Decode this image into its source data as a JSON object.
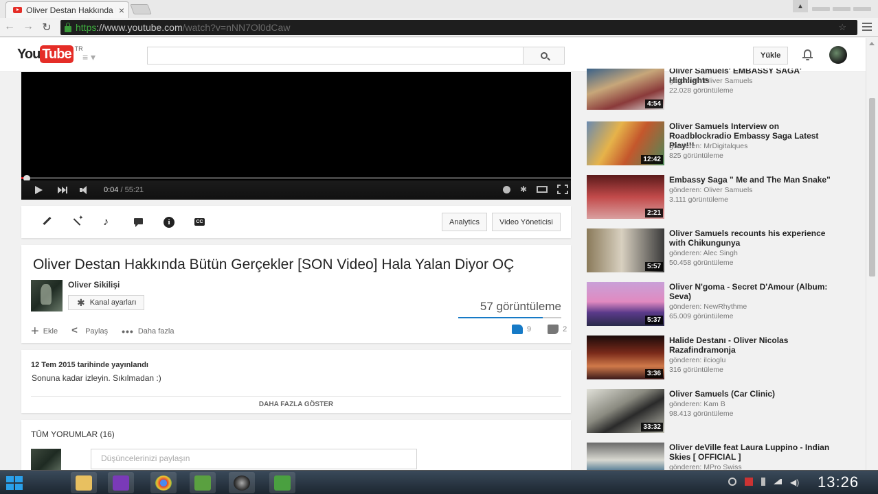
{
  "browser": {
    "tab_title": "Oliver Destan Hakkında Bü",
    "tab_close": "×",
    "url_https": "https",
    "url_host": "://www.youtube.com",
    "url_path": "/watch?v=nNN7Ol0dCaw"
  },
  "header": {
    "logo_you": "You",
    "logo_tube": "Tube",
    "logo_region": "TR",
    "upload_label": "Yükle"
  },
  "player": {
    "current_time": "0:04",
    "separator": " / ",
    "duration": "55:21",
    "progress_fraction": 0.0012
  },
  "creator_bar": {
    "analytics_label": "Analytics",
    "video_manager_label": "Video Yöneticisi"
  },
  "video": {
    "title": "Oliver Destan Hakkında Bütün Gerçekler [SON Video] Hala Yalan Diyor OÇ",
    "channel_name": "Oliver Sikilişi",
    "channel_settings_label": "Kanal ayarları",
    "views": "57 görüntüleme",
    "like_fraction": 0.82,
    "add_label": "Ekle",
    "share_label": "Paylaş",
    "more_label": "Daha fazla",
    "likes": "9",
    "dislikes": "2"
  },
  "description": {
    "published": "12 Tem 2015 tarihinde yayınlandı",
    "text": "Sonuna kadar izleyin. Sıkılmadan :)",
    "show_more": "DAHA FAZLA GÖSTER"
  },
  "comments": {
    "header": "TÜM YORUMLAR (16)",
    "placeholder": "Düşüncelerinizi paylaşın"
  },
  "related": [
    {
      "title": "Oliver Samuels' EMBASSY SAGA' Highlights",
      "channel": "gönderen: Oliver Samuels",
      "views": "22.028 görüntüleme",
      "duration": "4:54"
    },
    {
      "title": "Oliver Samuels Interview on Roadblockradio Embassy Saga Latest Play!!!",
      "channel": "gönderen: MrDigitalques",
      "views": "825 görüntüleme",
      "duration": "12:42"
    },
    {
      "title": "Embassy Saga \" Me and The Man Snake\"",
      "channel": "gönderen: Oliver Samuels",
      "views": "3.111 görüntüleme",
      "duration": "2:21"
    },
    {
      "title": "Oliver Samuels recounts his experience with Chikungunya",
      "channel": "gönderen: Alec Singh",
      "views": "50.458 görüntüleme",
      "duration": "5:57"
    },
    {
      "title": "Oliver N'goma - Secret D'Amour (Album: Seva)",
      "channel": "gönderen: NewRhythme",
      "views": "65.009 görüntüleme",
      "duration": "5:37"
    },
    {
      "title": "Halide Destanı - Oliver Nicolas Razafindramonja",
      "channel": "gönderen: ilcioglu",
      "views": "316 görüntüleme",
      "duration": "3:36"
    },
    {
      "title": "Oliver Samuels (Car Clinic)",
      "channel": "gönderen: Kam B",
      "views": "98.413 görüntüleme",
      "duration": "33:32"
    },
    {
      "title": "Oliver deVille feat Laura Luppino - Indian Skies [ OFFICIAL ]",
      "channel": "gönderen: MPro Swiss",
      "views": "",
      "duration": ""
    }
  ],
  "taskbar": {
    "clock": "13:26"
  },
  "colors": {
    "yt_red": "#e52d27",
    "like_blue": "#167ac6",
    "progress_red": "#cc181e"
  }
}
